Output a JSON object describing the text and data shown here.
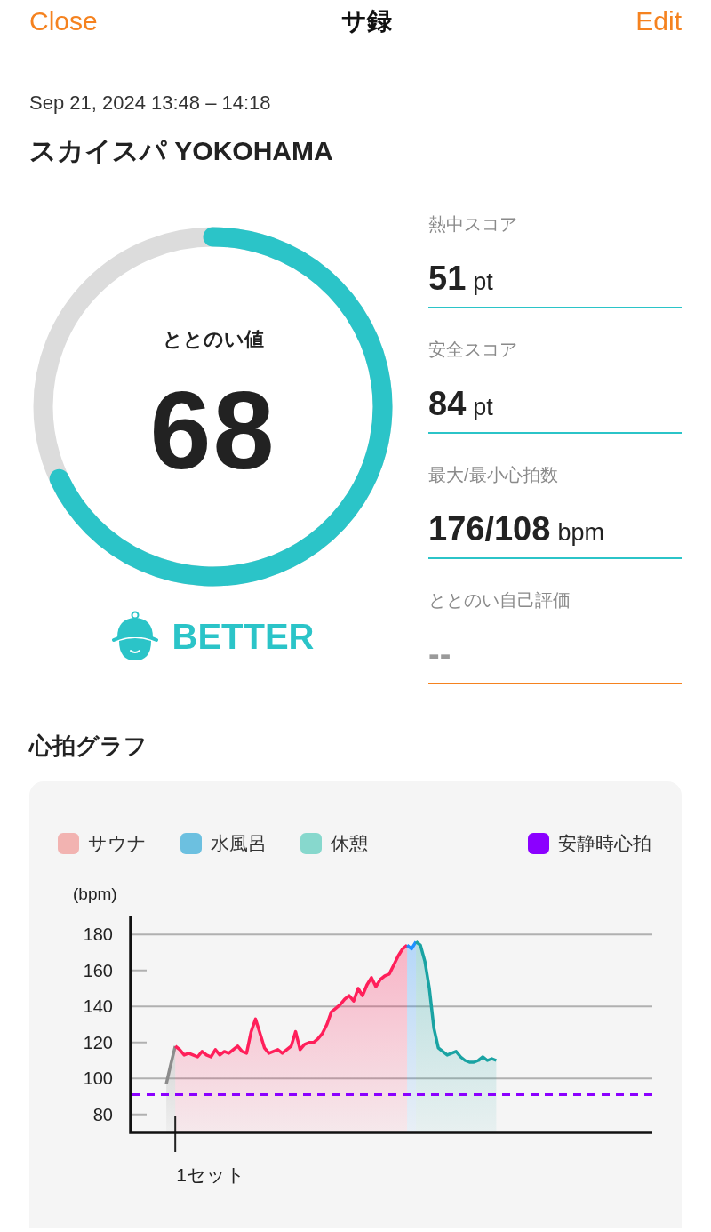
{
  "nav": {
    "left": "Close",
    "title": "サ録",
    "right": "Edit"
  },
  "session": {
    "datetime": "Sep 21, 2024 13:48 – 14:18",
    "place": "スカイスパ YOKOHAMA"
  },
  "score": {
    "label": "ととのい値",
    "value": "68",
    "rating": "BETTER"
  },
  "stats": [
    {
      "label": "熱中スコア",
      "value": "51",
      "unit": "pt",
      "kind": "filled"
    },
    {
      "label": "安全スコア",
      "value": "84",
      "unit": "pt",
      "kind": "filled"
    },
    {
      "label": "最大/最小心拍数",
      "value": "176/108",
      "unit": "bpm",
      "kind": "filled"
    },
    {
      "label": "ととのい自己評価",
      "value": "--",
      "kind": "empty"
    }
  ],
  "heart_graph": {
    "title": "心拍グラフ",
    "legend": [
      {
        "label": "サウナ",
        "color": "#f2b3b1",
        "kind": "phase"
      },
      {
        "label": "水風呂",
        "color": "#6cc0e0",
        "kind": "phase"
      },
      {
        "label": "休憩",
        "color": "#87d8cd",
        "kind": "phase"
      },
      {
        "label": "安静時心拍",
        "color": "#8b00ff",
        "kind": "baseline"
      }
    ],
    "chart_data": {
      "type": "area",
      "ylabel": "(bpm)",
      "ylim": [
        70,
        190
      ],
      "yticks": [
        80,
        100,
        120,
        140,
        160,
        180
      ],
      "grid": true,
      "categories": [
        null,
        null,
        null,
        null,
        null,
        null,
        null,
        null,
        null,
        null,
        null,
        null,
        null,
        null,
        null,
        null,
        null,
        null,
        null,
        null,
        null,
        null,
        null,
        null,
        null,
        null,
        null,
        null,
        null,
        null,
        null,
        null,
        null,
        null,
        null,
        null,
        null,
        null,
        null,
        null,
        null,
        null,
        null,
        null,
        null,
        null,
        null,
        null,
        null,
        null,
        null,
        null,
        null,
        null,
        null,
        null,
        null,
        null,
        null,
        null,
        null,
        null,
        null,
        null,
        null,
        null,
        null,
        null,
        null,
        null,
        null,
        null,
        null,
        null,
        null,
        null,
        null,
        null,
        null,
        null,
        null,
        null,
        null,
        null,
        null,
        null,
        null,
        null,
        null,
        null,
        null,
        null,
        null,
        null,
        null,
        null,
        null,
        null,
        null,
        null,
        null,
        null,
        null,
        null,
        null,
        null,
        null,
        null,
        null,
        null,
        null,
        null,
        null,
        null,
        null,
        null,
        null,
        null
      ],
      "series": [
        {
          "color": "#8c8c8c",
          "values": [
            null,
            null,
            null,
            null,
            null,
            null,
            null,
            null,
            97,
            108,
            118,
            null,
            null,
            null,
            null,
            null,
            null,
            null,
            null,
            null,
            null,
            null,
            null,
            null,
            null,
            null,
            null,
            null,
            null,
            null,
            null,
            null,
            null,
            null,
            null,
            null,
            null,
            null,
            null,
            null,
            null,
            null,
            null,
            null,
            null,
            null,
            null,
            null,
            null,
            null,
            null,
            null,
            null,
            null,
            null,
            null,
            null,
            null,
            null,
            null,
            null,
            null,
            null,
            null,
            null,
            null,
            null,
            null,
            null,
            null,
            null,
            null,
            null,
            null,
            null,
            null,
            null,
            null,
            null,
            null,
            null,
            null,
            null,
            null,
            null,
            null,
            null,
            null,
            null,
            null,
            null,
            null,
            null,
            null,
            null,
            null,
            null,
            null,
            null,
            null,
            null,
            null,
            null,
            null,
            null,
            null,
            null,
            null,
            null,
            null,
            null,
            null,
            null,
            null,
            null,
            null,
            null,
            null
          ]
        },
        {
          "color": "#ff1f5a",
          "values": [
            null,
            null,
            null,
            null,
            null,
            null,
            null,
            null,
            null,
            null,
            118,
            116,
            113,
            114,
            113,
            112,
            115,
            113,
            112,
            116,
            113,
            115,
            114,
            116,
            118,
            115,
            114,
            126,
            133,
            125,
            117,
            114,
            115,
            116,
            114,
            116,
            118,
            126,
            116,
            119,
            120,
            120,
            122,
            125,
            130,
            137,
            139,
            141,
            144,
            146,
            143,
            150,
            146,
            152,
            156,
            151,
            155,
            157,
            158,
            163,
            168,
            172,
            174,
            null,
            null,
            null,
            null,
            null,
            null,
            null,
            null,
            null,
            null,
            null,
            null,
            null,
            null,
            null,
            null,
            null,
            null,
            null,
            null,
            null,
            null,
            null,
            null,
            null,
            null,
            null,
            null,
            null,
            null,
            null,
            null,
            null,
            null,
            null,
            null,
            null,
            null,
            null,
            null,
            null,
            null,
            null,
            null,
            null,
            null,
            null,
            null,
            null,
            null,
            null,
            null,
            null,
            null,
            null
          ]
        },
        {
          "color": "#1e90ff",
          "values": [
            null,
            null,
            null,
            null,
            null,
            null,
            null,
            null,
            null,
            null,
            null,
            null,
            null,
            null,
            null,
            null,
            null,
            null,
            null,
            null,
            null,
            null,
            null,
            null,
            null,
            null,
            null,
            null,
            null,
            null,
            null,
            null,
            null,
            null,
            null,
            null,
            null,
            null,
            null,
            null,
            null,
            null,
            null,
            null,
            null,
            null,
            null,
            null,
            null,
            null,
            null,
            null,
            null,
            null,
            null,
            null,
            null,
            null,
            null,
            null,
            null,
            null,
            174,
            172,
            176,
            null,
            null,
            null,
            null,
            null,
            null,
            null,
            null,
            null,
            null,
            null,
            null,
            null,
            null,
            null,
            null,
            null,
            null,
            null,
            null,
            null,
            null,
            null,
            null,
            null,
            null,
            null,
            null,
            null,
            null,
            null,
            null,
            null,
            null,
            null,
            null,
            null,
            null,
            null,
            null,
            null,
            null,
            null,
            null,
            null,
            null,
            null,
            null,
            null,
            null,
            null,
            null,
            null
          ]
        },
        {
          "color": "#1aa3a3",
          "values": [
            null,
            null,
            null,
            null,
            null,
            null,
            null,
            null,
            null,
            null,
            null,
            null,
            null,
            null,
            null,
            null,
            null,
            null,
            null,
            null,
            null,
            null,
            null,
            null,
            null,
            null,
            null,
            null,
            null,
            null,
            null,
            null,
            null,
            null,
            null,
            null,
            null,
            null,
            null,
            null,
            null,
            null,
            null,
            null,
            null,
            null,
            null,
            null,
            null,
            null,
            null,
            null,
            null,
            null,
            null,
            null,
            null,
            null,
            null,
            null,
            null,
            null,
            null,
            null,
            176,
            174,
            165,
            150,
            128,
            117,
            115,
            113,
            114,
            115,
            112,
            110,
            109,
            109,
            110,
            112,
            110,
            111,
            110,
            null,
            null,
            null,
            null,
            null,
            null,
            null,
            null,
            null,
            null,
            null,
            null,
            null,
            null,
            null,
            null,
            null,
            null,
            null,
            null,
            null,
            null,
            null,
            null,
            null,
            null,
            null,
            null,
            null,
            null,
            null,
            null,
            null,
            null,
            null
          ]
        }
      ],
      "ref_lines": [
        {
          "axis": "y",
          "value": 91
        }
      ]
    },
    "set_label": "1セット"
  }
}
